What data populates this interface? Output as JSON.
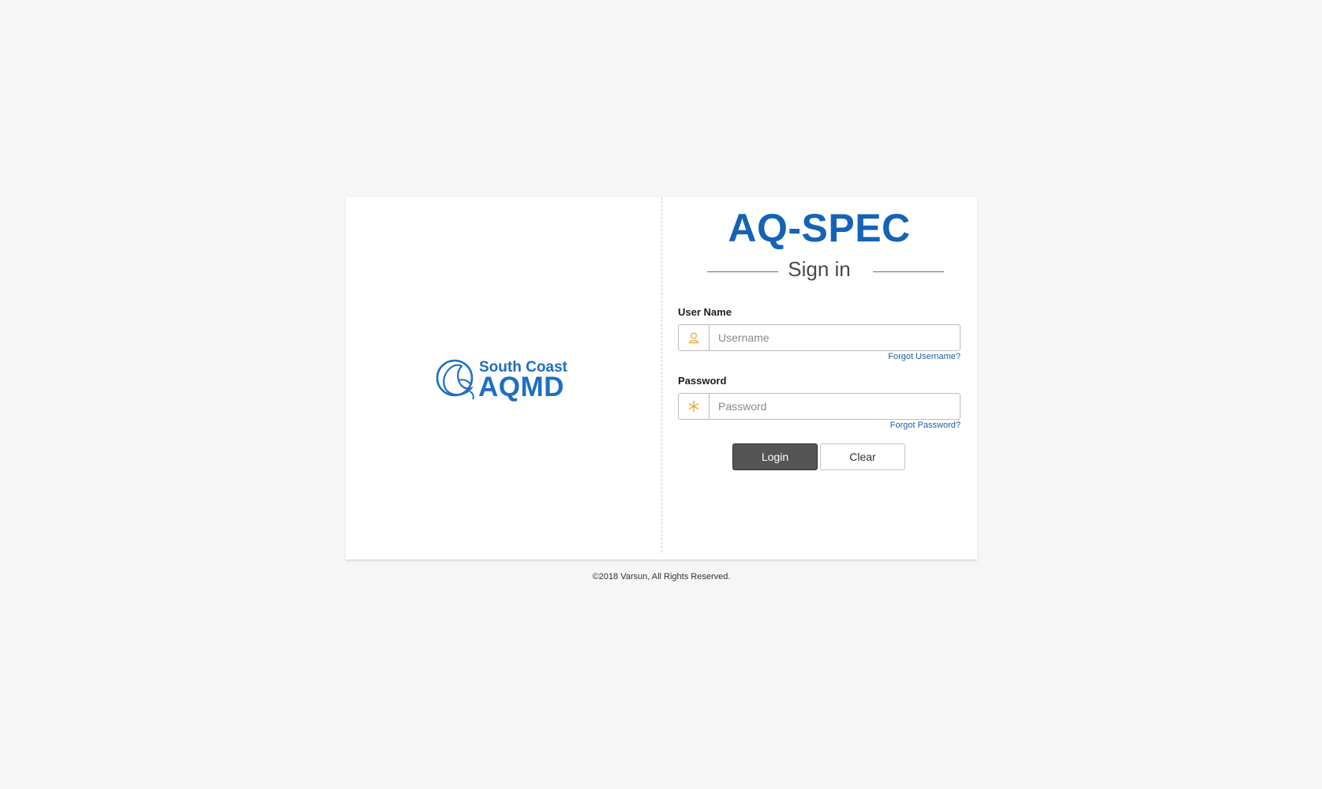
{
  "brand": {
    "logo_line1": "South Coast",
    "logo_line2": "AQMD",
    "logo_color": "#1e6fc0"
  },
  "app": {
    "title": "AQ-SPEC",
    "title_color": "#1463b6",
    "subtitle": "Sign in"
  },
  "form": {
    "username": {
      "label": "User Name",
      "placeholder": "Username",
      "value": "",
      "icon": "user-icon",
      "forgot_link": "Forgot Username?"
    },
    "password": {
      "label": "Password",
      "placeholder": "Password",
      "value": "",
      "icon": "asterisk-icon",
      "forgot_link": "Forgot Password?"
    },
    "icon_color": "#f0a830",
    "login_label": "Login",
    "clear_label": "Clear"
  },
  "footer": {
    "copyright": "©2018 Varsun, All Rights Reserved."
  }
}
